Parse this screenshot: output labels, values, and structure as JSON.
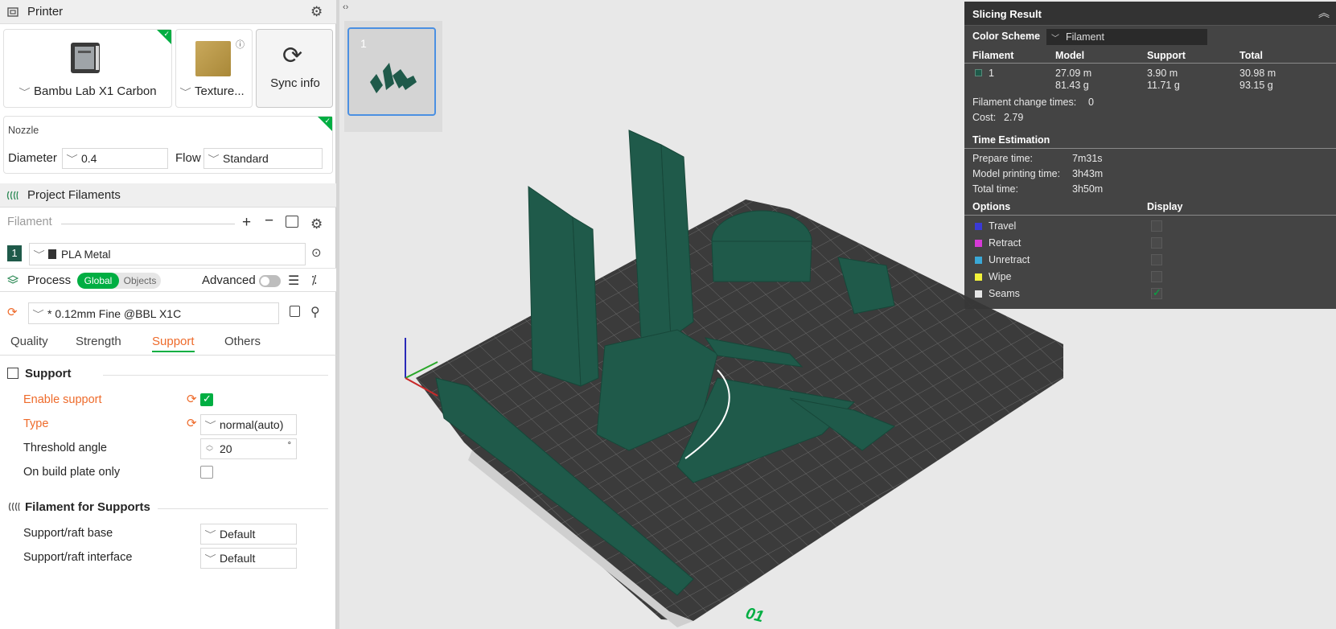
{
  "printer": {
    "title": "Printer",
    "printer_name": "Bambu Lab X1 Carbon",
    "plate_name": "Texture...",
    "sync_label": "Sync info",
    "nozzle_title": "Nozzle",
    "diameter_label": "Diameter",
    "diameter_value": "0.4",
    "flow_label": "Flow",
    "flow_value": "Standard"
  },
  "filaments": {
    "title": "Project Filaments",
    "filament_label": "Filament",
    "items": [
      {
        "index": "1",
        "name": "PLA Metal",
        "color": "#1f5a4a"
      }
    ]
  },
  "process": {
    "title": "Process",
    "toggle_global": "Global",
    "toggle_objects": "Objects",
    "advanced_label": "Advanced",
    "preset": "* 0.12mm Fine @BBL X1C",
    "tabs": [
      "Quality",
      "Strength",
      "Support",
      "Others"
    ],
    "active_tab": "Support",
    "support_group": "Support",
    "enable_support_label": "Enable support",
    "type_label": "Type",
    "type_value": "normal(auto)",
    "threshold_label": "Threshold angle",
    "threshold_value": "20",
    "threshold_unit": "°",
    "build_plate_only_label": "On build plate only",
    "filament_group": "Filament for Supports",
    "raft_base_label": "Support/raft base",
    "raft_base_value": "Default",
    "raft_interface_label": "Support/raft interface",
    "raft_interface_value": "Default"
  },
  "viewport": {
    "plate_thumb_label": "1",
    "plate_number": "01"
  },
  "slicing": {
    "title": "Slicing Result",
    "color_scheme_label": "Color Scheme",
    "color_scheme_value": "Filament",
    "col_filament": "Filament",
    "col_model": "Model",
    "col_support": "Support",
    "col_total": "Total",
    "row": {
      "index": "1",
      "model_len": "27.09 m",
      "model_wt": "81.43 g",
      "support_len": "3.90 m",
      "support_wt": "11.71 g",
      "total_len": "30.98 m",
      "total_wt": "93.15 g"
    },
    "change_times_label": "Filament change times:",
    "change_times_value": "0",
    "cost_label": "Cost:",
    "cost_value": "2.79",
    "time_title": "Time Estimation",
    "prepare_label": "Prepare time:",
    "prepare_value": "7m31s",
    "model_time_label": "Model printing time:",
    "model_time_value": "3h43m",
    "total_time_label": "Total time:",
    "total_time_value": "3h50m",
    "options_label": "Options",
    "display_label": "Display",
    "options": [
      {
        "name": "Travel",
        "color": "#3a3ad6",
        "checked": false
      },
      {
        "name": "Retract",
        "color": "#d63ad6",
        "checked": false
      },
      {
        "name": "Unretract",
        "color": "#3aa8d6",
        "checked": false
      },
      {
        "name": "Wipe",
        "color": "#f2f23a",
        "checked": false
      },
      {
        "name": "Seams",
        "color": "#e6e6e6",
        "checked": true
      }
    ]
  },
  "colors": {
    "accent": "#00ae42",
    "modified": "#ee6b2b",
    "model": "#1f5a4a"
  }
}
